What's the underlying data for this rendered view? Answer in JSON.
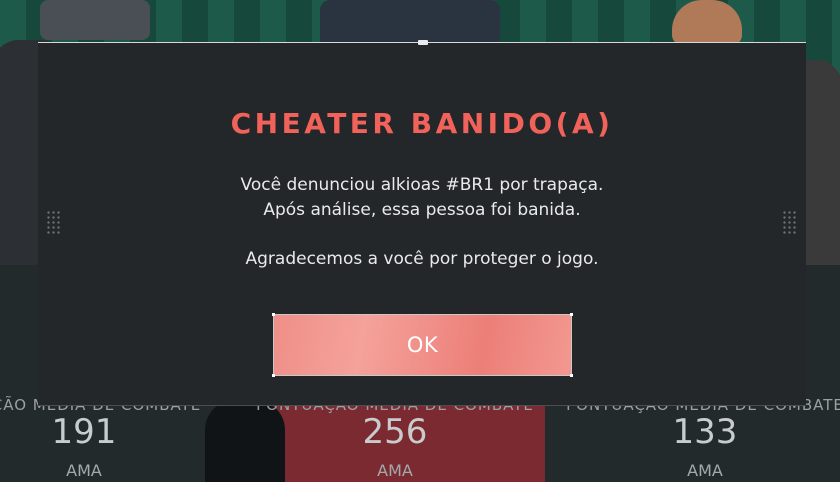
{
  "modal": {
    "title": "CHEATER BANIDO(A)",
    "line1": "Você denunciou alkioas #BR1 por trapaça.",
    "line2": "Após análise, essa pessoa foi banida.",
    "line3": "Agradecemos a você por proteger o jogo.",
    "ok_label": "OK"
  },
  "background_stats": [
    {
      "label": "UAÇÃO MÉDIA DE COMBATE",
      "value": "191",
      "rank": "AMA"
    },
    {
      "label": "PONTUAÇÃO MÉDIA DE COMBATE",
      "value": "256",
      "rank": "AMA"
    },
    {
      "label": "PONTUAÇÃO MÉDIA DE COMBATE",
      "value": "133",
      "rank": "AMA"
    }
  ],
  "colors": {
    "title": "#f0625a",
    "button": "#ef8f88",
    "modal_bg": "#242729"
  }
}
